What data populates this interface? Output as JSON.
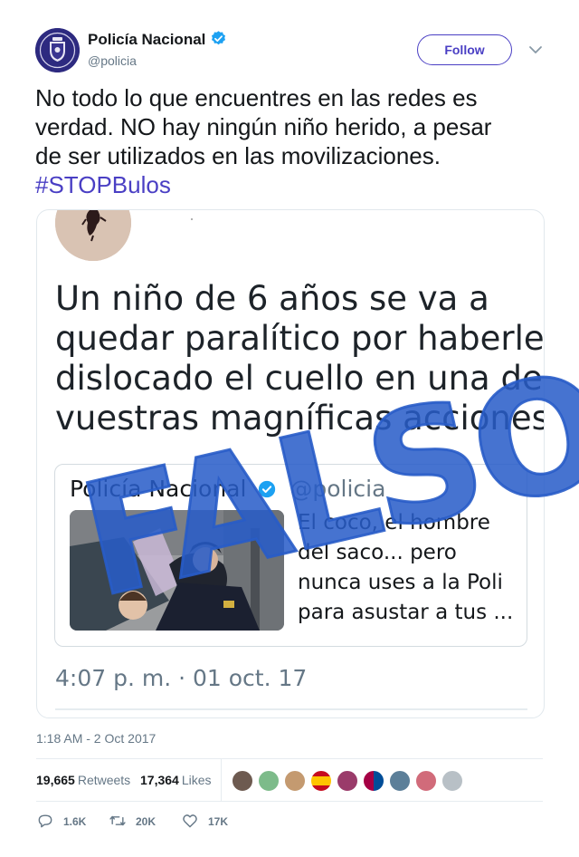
{
  "account": {
    "name": "Policía Nacional",
    "handle": "@policia",
    "follow_label": "Follow"
  },
  "tweet": {
    "text_lines": [
      "No todo lo que encuentres en las redes es",
      "verdad. NO hay ningún niño herido, a pesar",
      "de ser utilizados en las movilizaciones."
    ],
    "hashtag": "#STOPBulos"
  },
  "media": {
    "quote_lines": [
      "Un niño de 6 años se va a",
      "quedar paralítico por haberle",
      "dislocado el cuello en una de",
      "vuestras magníficas acciones"
    ],
    "embedded": {
      "name": "Policía Nacional",
      "handle": "@policia",
      "text_lines": [
        "El coco, el hombre",
        "del saco... pero",
        "nunca uses a la Poli",
        "para asustar a tus ..."
      ]
    },
    "time": "4:07 p. m. · 01 oct. 17",
    "stamp": "FALSO"
  },
  "meta": {
    "timestamp": "1:18 AM - 2 Oct 2017",
    "retweets_count": "19,665",
    "retweets_label": "Retweets",
    "likes_count": "17,364",
    "likes_label": "Likes"
  },
  "actions": {
    "replies": "1.6K",
    "retweets": "20K",
    "likes": "17K"
  },
  "colors": {
    "accent": "#4a3fc4",
    "verified": "#1da1f2",
    "stamp": "#285cc8",
    "muted": "#657786"
  },
  "icons": [
    "verified-badge-icon",
    "chevron-down-icon",
    "reply-icon",
    "retweet-icon",
    "heart-icon"
  ]
}
